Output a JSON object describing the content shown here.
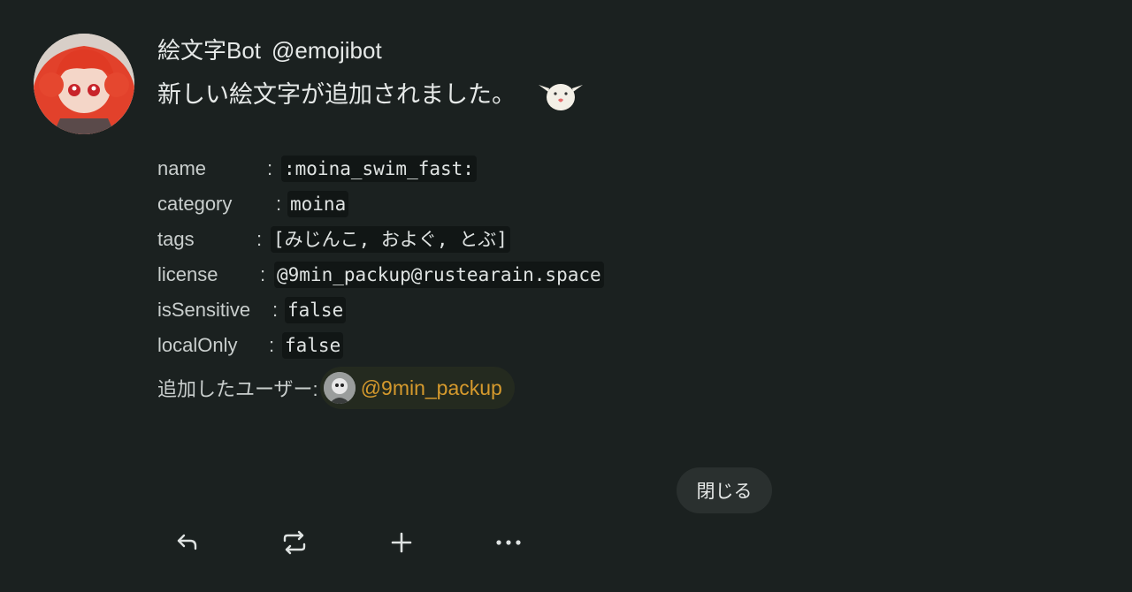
{
  "note": {
    "author": {
      "display_name": "絵文字Bot",
      "username": "@emojibot",
      "avatar_icon": "avatar-icon"
    },
    "text": "新しい絵文字が追加されました。",
    "emoji_icon": "moina-emoji-icon",
    "fields": [
      {
        "key": "name",
        "value": ":moina_swim_fast:"
      },
      {
        "key": "category",
        "value": "moina"
      },
      {
        "key": "tags",
        "value": "[みじんこ, およぐ, とぶ]"
      },
      {
        "key": "license",
        "value": "@9min_packup@rustearain.space"
      },
      {
        "key": "isSensitive",
        "value": "false"
      },
      {
        "key": "localOnly",
        "value": "false"
      }
    ],
    "added_by": {
      "label": "追加したユーザー:",
      "mention": "@9min_packup"
    },
    "colon": ":",
    "close_label": "閉じる"
  },
  "footer": {
    "icons": [
      "reply-icon",
      "renote-icon",
      "plus-icon",
      "more-icon"
    ]
  },
  "colors": {
    "background": "#1b2120",
    "text": "#e6e9e8",
    "mention": "#d69a2d",
    "code_bg": "#111615",
    "button_bg": "#2a302f"
  }
}
